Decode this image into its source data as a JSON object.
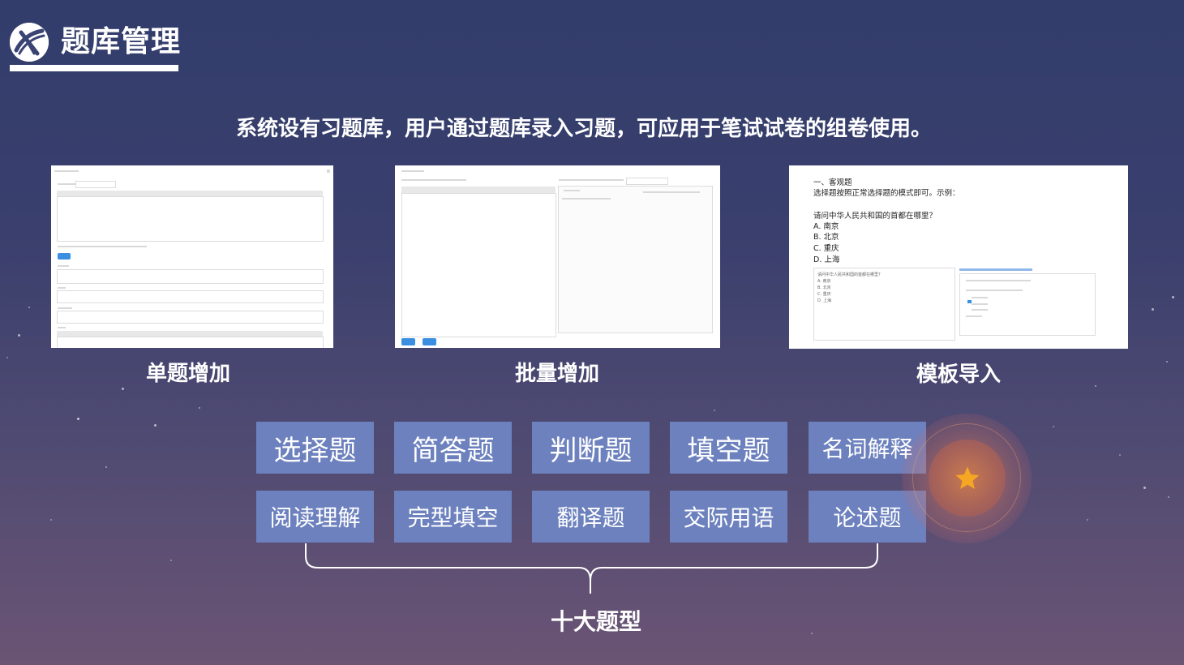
{
  "header": {
    "title": "题库管理",
    "subtitle": "系统设有习题库，用户通过题库录入习题，可应用于笔试试卷的组卷使用。"
  },
  "screens": [
    {
      "caption": "单题增加"
    },
    {
      "caption": "批量增加"
    },
    {
      "caption": "模板导入",
      "template_lines": [
        "一、客观题",
        "选择题按照正常选择题的模式即可。示例：",
        "",
        "请问中华人民共和国的首都在哪里？",
        "A. 南京",
        "B. 北京",
        "C. 重庆",
        "D. 上海"
      ],
      "preview_lines": [
        "请问中华人民共和国的首都在哪里?",
        "A. 南京",
        "B. 北京",
        "C. 重庆",
        "D. 上海"
      ]
    }
  ],
  "question_types": {
    "row1": [
      "选择题",
      "简答题",
      "判断题",
      "填空题",
      "名词解释"
    ],
    "row2": [
      "阅读理解",
      "完型填空",
      "翻译题",
      "交际用语",
      "论述题"
    ],
    "label": "十大题型"
  },
  "colors": {
    "tile": "#6c81be",
    "accent": "#f5a623"
  },
  "icons": {
    "logo": "brand-logo-icon",
    "badge": "star-icon"
  }
}
